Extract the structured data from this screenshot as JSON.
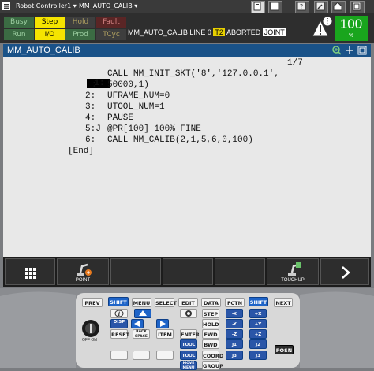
{
  "topbar": {
    "controller": "Robot Controller1",
    "program": "MM_AUTO_CALIB"
  },
  "status": {
    "busy": "Busy",
    "step": "Step",
    "hold": "Hold",
    "fault": "Fault",
    "run": "Run",
    "io": "I/O",
    "prod": "Prod",
    "tcyc": "TCyc"
  },
  "info": {
    "program": "MM_AUTO_CALIB",
    "line": "LINE 0",
    "mode": "T2",
    "state": "ABORTED",
    "coord": "JOINT"
  },
  "override": {
    "value": "100",
    "unit": "%"
  },
  "editor": {
    "title": "MM_AUTO_CALIB",
    "page": "1/7",
    "lines": [
      {
        "num": "1:",
        "text": "CALL MM_INIT_SKT('8','127.0.0.1',"
      },
      {
        "num": ":",
        "text": "50000,1)"
      },
      {
        "num": "2:",
        "text": "UFRAME_NUM=0"
      },
      {
        "num": "3:",
        "text": "UTOOL_NUM=1"
      },
      {
        "num": "4:",
        "text": "PAUSE"
      },
      {
        "num": "5:J",
        "text": "@PR[100] 100% FINE"
      },
      {
        "num": "6:",
        "text": "CALL MM_CALIB(2,1,5,6,0,100)"
      }
    ],
    "end": "[End]"
  },
  "fkeys": {
    "point": "POINT",
    "touchup": "TOUCHUP"
  },
  "keys": {
    "prev": "PREV",
    "shift": "SHIFT",
    "menu": "MENU",
    "select": "SELECT",
    "edit": "EDIT",
    "data": "DATA",
    "fctn": "FCTN",
    "next": "NEXT",
    "disp": "DISP",
    "reset": "RESET",
    "backspace": "BACK SPACE",
    "item": "ITEM",
    "enter": "ENTER",
    "step": "STEP",
    "hold": "HOLD",
    "fwd": "FWD",
    "bwd": "BWD",
    "coord": "COORD",
    "group": "GROUP",
    "tool": "TOOL",
    "moveMenu": "MOVE MENU",
    "posn": "POSN",
    "offOn": "OFF ON",
    "xn": "-X",
    "xp": "+X",
    "yn": "-Y",
    "yp": "+Y",
    "zn": "-Z",
    "zp": "+Z",
    "j1": "J1",
    "j2": "J2",
    "j3": "J3"
  }
}
